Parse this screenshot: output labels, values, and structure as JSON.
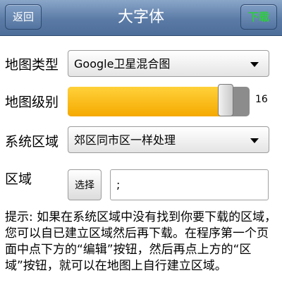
{
  "header": {
    "back_label": "返回",
    "title": "大字体",
    "download_label": "下载"
  },
  "map_type": {
    "label": "地图类型",
    "value": "Google卫星混合图"
  },
  "map_level": {
    "label": "地图级别",
    "value": "16",
    "fill_fraction": 0.87
  },
  "system_area": {
    "label": "系统区域",
    "value": "郊区同市区一样处理"
  },
  "region": {
    "label": "区域",
    "choose_label": "选择",
    "value": ";"
  },
  "hint": "提示: 如果在系统区域中没有找到你要下载的区域，您可以自已建立区域然后再下载。在程序第一个页面中点下方的“编辑”按钮，然后再点上方的“区域”按钮，就可以在地图上自行建立区域。"
}
